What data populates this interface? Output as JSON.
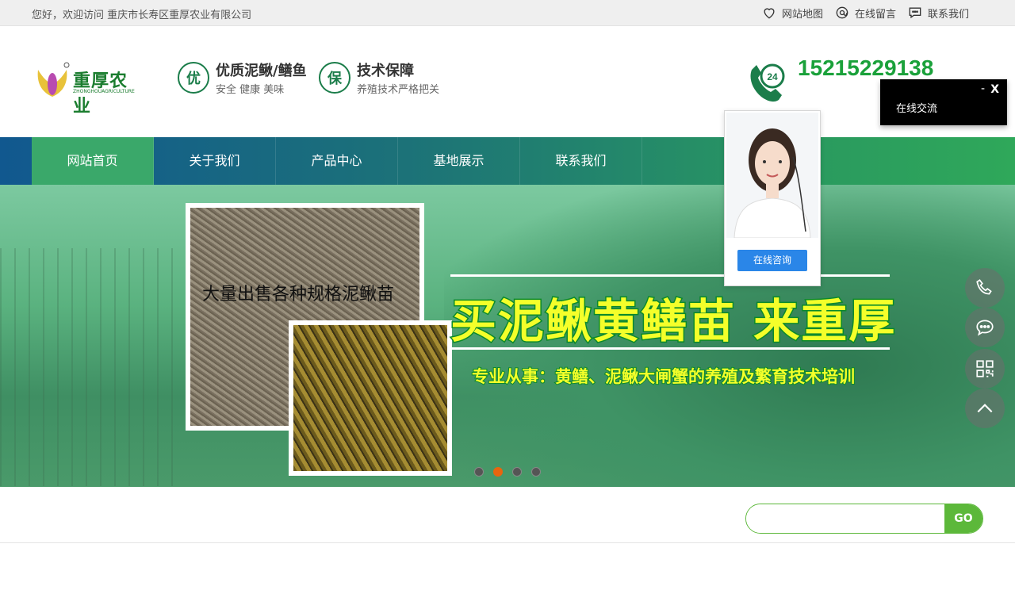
{
  "topbar": {
    "welcome": "您好，欢迎访问 重庆市长寿区重厚农业有限公司",
    "links": [
      {
        "label": "网站地图",
        "icon": "heart-icon"
      },
      {
        "label": "在线留言",
        "icon": "at-icon"
      },
      {
        "label": "联系我们",
        "icon": "chat-bubble-icon"
      }
    ]
  },
  "header": {
    "logo_text": "重厚农业",
    "logo_sub": "ZHONGHOUAGRICULTURE",
    "features": [
      {
        "badge": "优",
        "title": "优质泥鳅/鳝鱼",
        "subtitle": "安全 健康 美味"
      },
      {
        "badge": "保",
        "title": "技术保障",
        "subtitle": "养殖技术严格把关"
      }
    ],
    "phone": "15215229138"
  },
  "nav": {
    "items": [
      "网站首页",
      "关于我们",
      "产品中心",
      "基地展示",
      "联系我们"
    ],
    "active_index": 0
  },
  "banner": {
    "photo_caption": "大量出售各种规格泥鳅苗",
    "headline": "买泥鳅黄鳝苗 来重厚",
    "subline": "专业从事：黄鳝、泥鳅大闸蟹的养殖及繁育技术培训",
    "slides": 4,
    "active_slide": 1
  },
  "search": {
    "placeholder": "",
    "button": "GO"
  },
  "consult": {
    "button": "在线咨询"
  },
  "chat_widget": {
    "title": "在线交流",
    "minimize": "-",
    "close": "X"
  },
  "side_buttons": [
    "phone-icon",
    "message-icon",
    "qrcode-icon",
    "back-to-top-icon"
  ],
  "colors": {
    "brand_green": "#1aa13a",
    "nav_active": "#3aa86a",
    "dot_active": "#e8650f",
    "search_green": "#5cb83a",
    "consult_blue": "#2a86e8"
  }
}
